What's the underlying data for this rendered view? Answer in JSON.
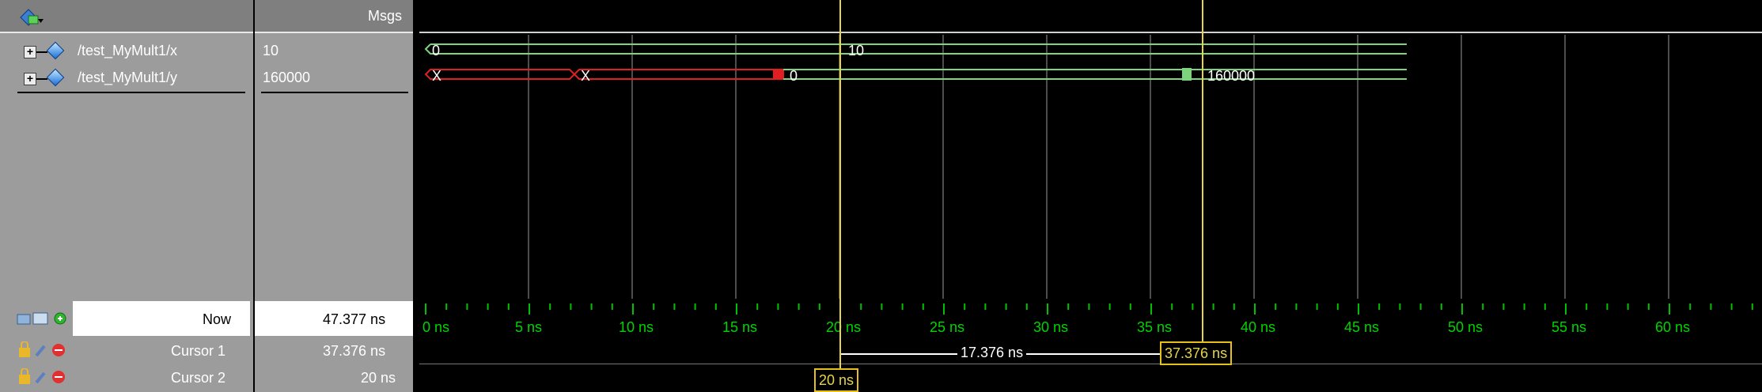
{
  "header": {
    "msgs_label": "Msgs"
  },
  "signals": [
    {
      "name": "/test_MyMult1/x",
      "value": "10"
    },
    {
      "name": "/test_MyMult1/y",
      "value": "160000"
    }
  ],
  "waveforms": {
    "x": {
      "seg1": "0",
      "seg2": "10"
    },
    "y": {
      "seg1": "X",
      "seg2": "X",
      "seg3": "0",
      "seg4": "160000"
    }
  },
  "timeline": {
    "ticks": [
      "0 ns",
      "5 ns",
      "10 ns",
      "15 ns",
      "20 ns",
      "25 ns",
      "30 ns",
      "35 ns",
      "40 ns",
      "45 ns",
      "50 ns",
      "55 ns",
      "60 ns"
    ]
  },
  "footer": {
    "now_label": "Now",
    "now_value": "47.377 ns",
    "cursor1_label": "Cursor 1",
    "cursor1_value": "37.376 ns",
    "cursor2_label": "Cursor 2",
    "cursor2_value": "20 ns",
    "delta": "17.376 ns",
    "cursor1_box": "37.376 ns",
    "cursor2_box": "20 ns"
  },
  "colors": {
    "wave_green": "#7cd47c",
    "x_red": "#e02020",
    "cursor": "#e8d44a"
  }
}
